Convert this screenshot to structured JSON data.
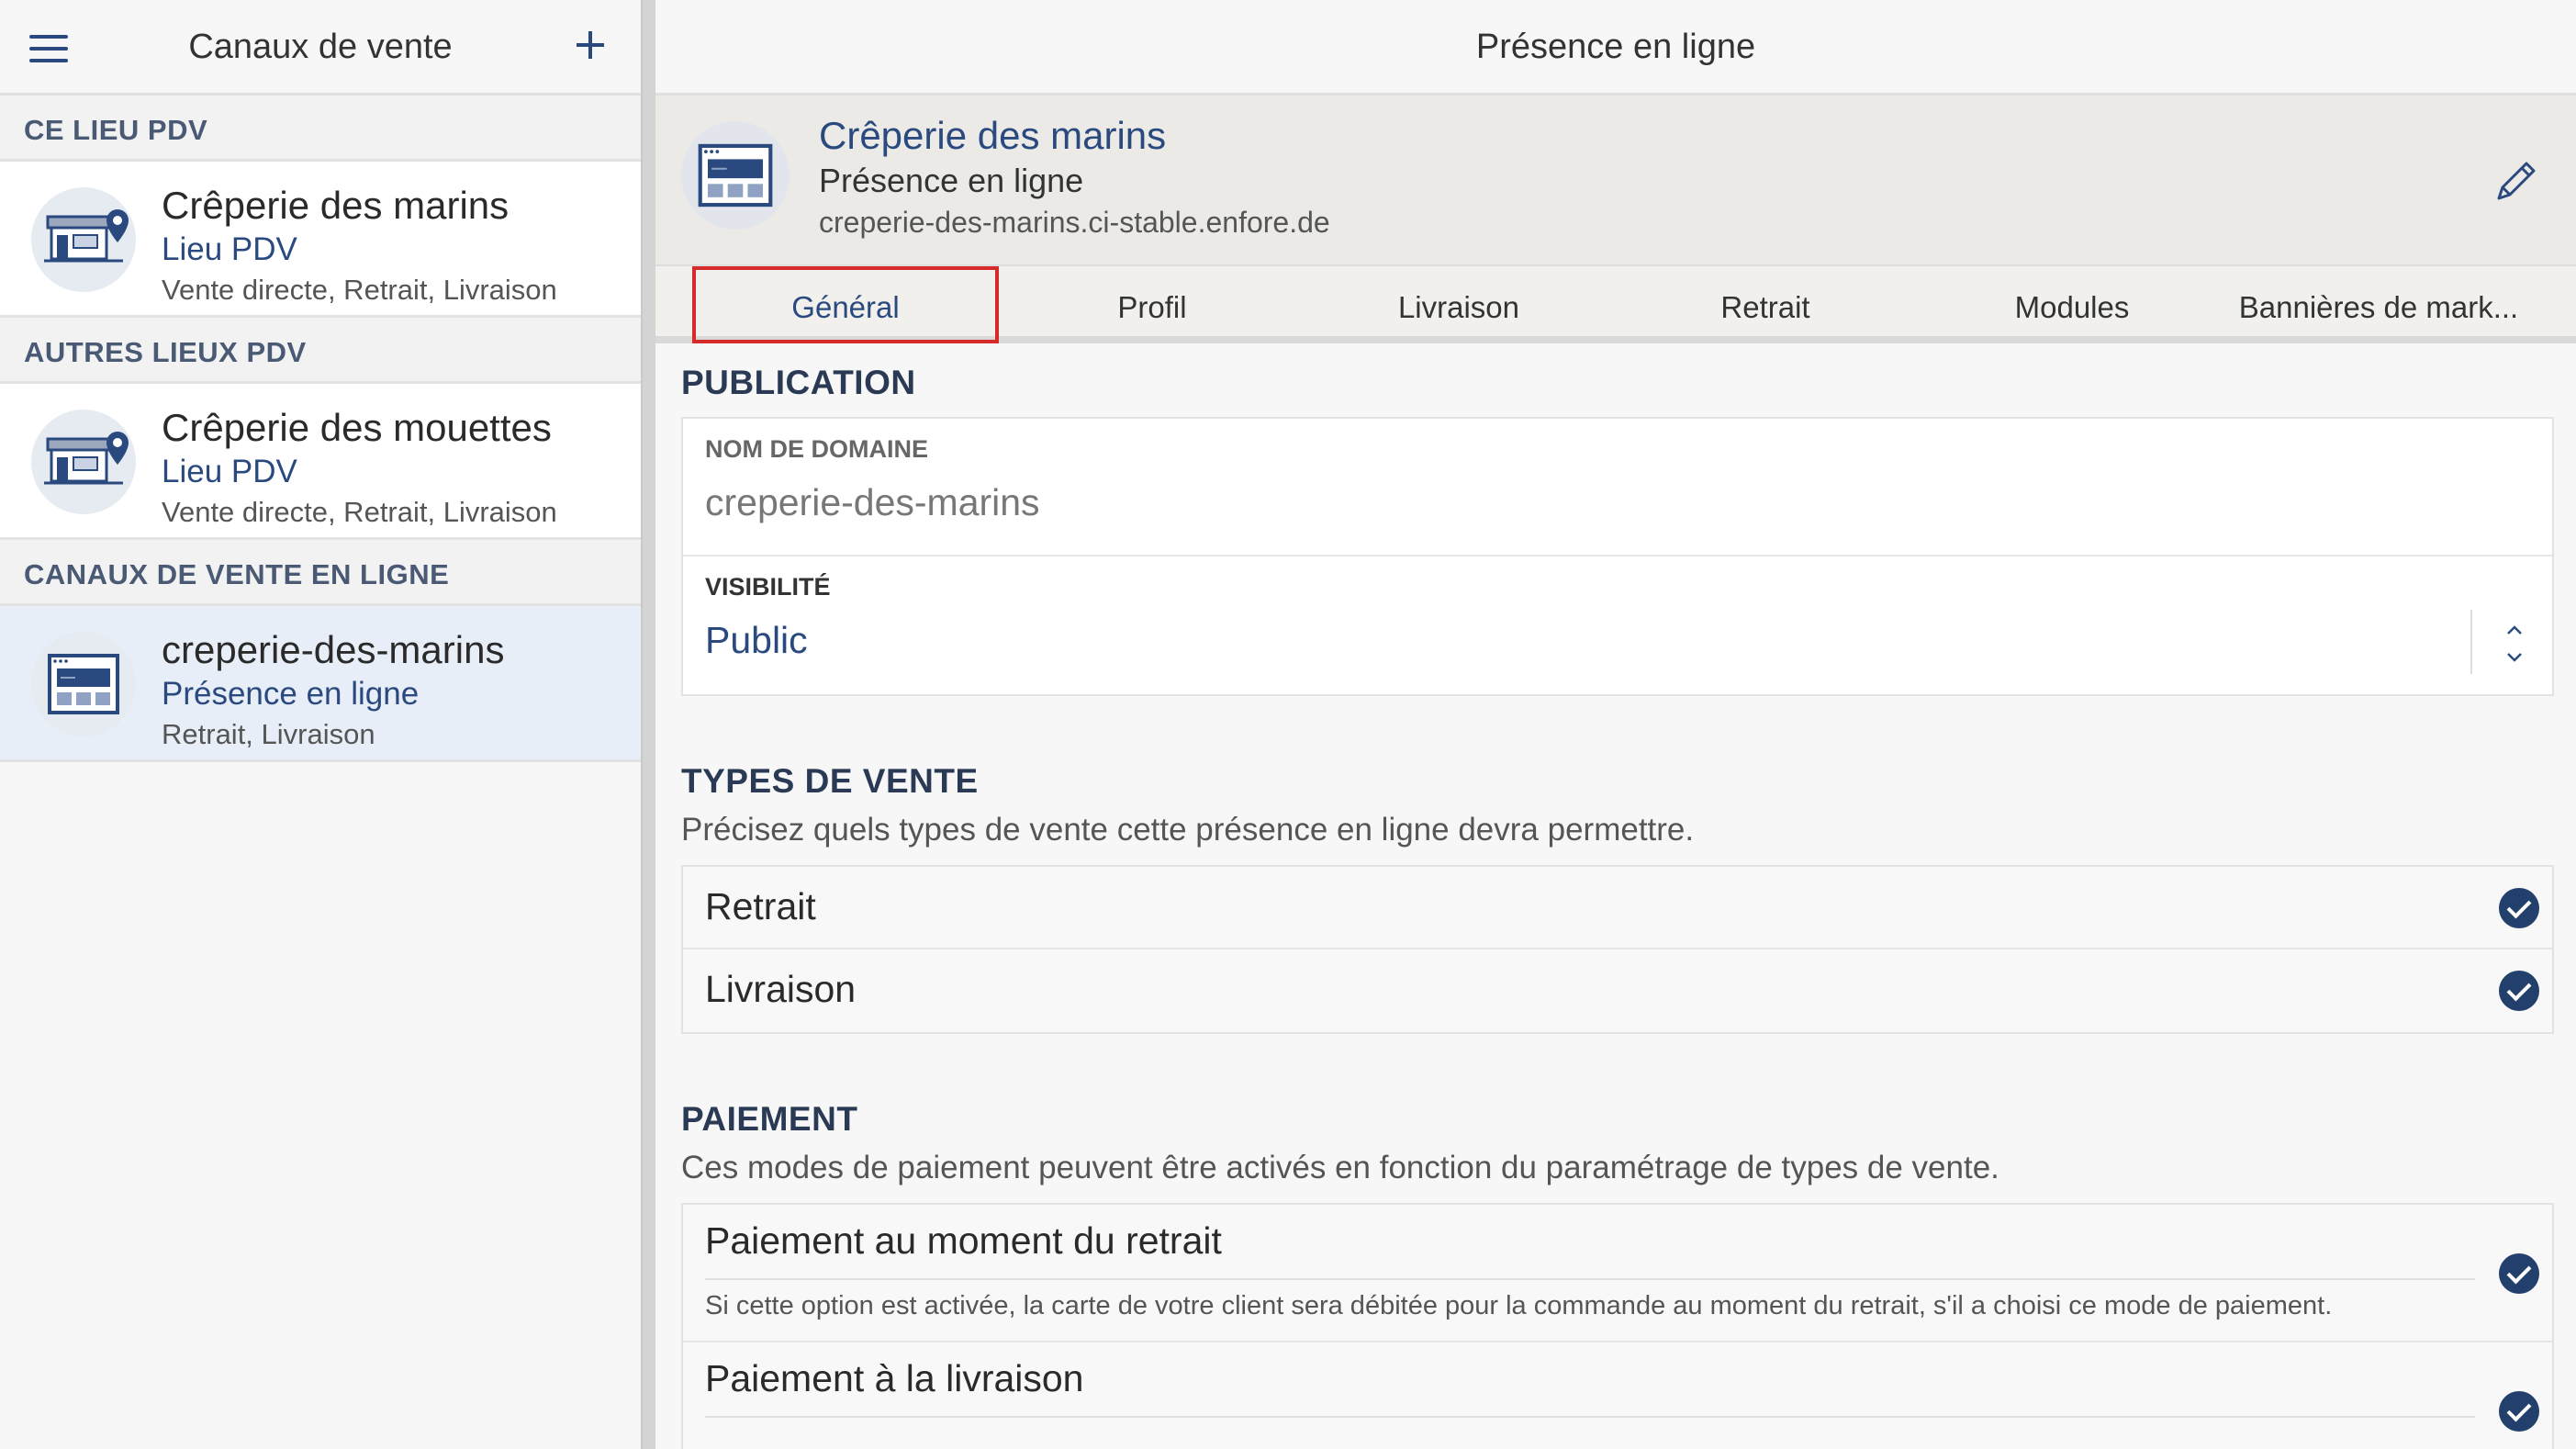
{
  "sidebar": {
    "title": "Canaux de vente",
    "sections": [
      {
        "title": "CE LIEU PDV"
      },
      {
        "title": "AUTRES LIEUX PDV"
      },
      {
        "title": "CANAUX DE VENTE EN LIGNE"
      }
    ],
    "items": [
      {
        "name": "Crêperie des marins",
        "type": "Lieu PDV",
        "modes": "Vente directe, Retrait, Livraison",
        "icon": "store-location-icon"
      },
      {
        "name": "Crêperie des mouettes",
        "type": "Lieu PDV",
        "modes": "Vente directe, Retrait, Livraison",
        "icon": "store-location-icon"
      },
      {
        "name": "creperie-des-marins",
        "type": "Présence en ligne",
        "modes": "Retrait, Livraison",
        "icon": "browser-window-icon"
      }
    ]
  },
  "main": {
    "title": "Présence en ligne",
    "channel": {
      "name": "Crêperie des marins",
      "type": "Présence en ligne",
      "domain": "creperie-des-marins.ci-stable.enfore.de"
    },
    "tabs": [
      "Général",
      "Profil",
      "Livraison",
      "Retrait",
      "Modules",
      "Bannières de mark..."
    ],
    "active_tab": "Général",
    "publication": {
      "title": "PUBLICATION",
      "domain_label": "NOM DE DOMAINE",
      "domain_value": "creperie-des-marins",
      "visibility_label": "VISIBILITÉ",
      "visibility_value": "Public"
    },
    "sale_types": {
      "title": "TYPES DE VENTE",
      "desc": "Précisez quels types de vente cette présence en ligne devra permettre.",
      "items": [
        {
          "label": "Retrait",
          "checked": true
        },
        {
          "label": "Livraison",
          "checked": true
        }
      ]
    },
    "payment": {
      "title": "PAIEMENT",
      "desc": "Ces modes de paiement peuvent être activés en fonction du paramétrage de types de vente.",
      "items": [
        {
          "label": "Paiement au moment du retrait",
          "hint": "Si cette option est activée, la carte de votre client sera débitée pour la commande au moment du retrait, s'il a choisi ce mode de paiement.",
          "checked": true
        },
        {
          "label": "Paiement à la livraison",
          "checked": true
        }
      ]
    }
  },
  "colors": {
    "accent": "#2a4a7f",
    "check": "#23406d",
    "tab_highlight": "#d62b2b"
  }
}
